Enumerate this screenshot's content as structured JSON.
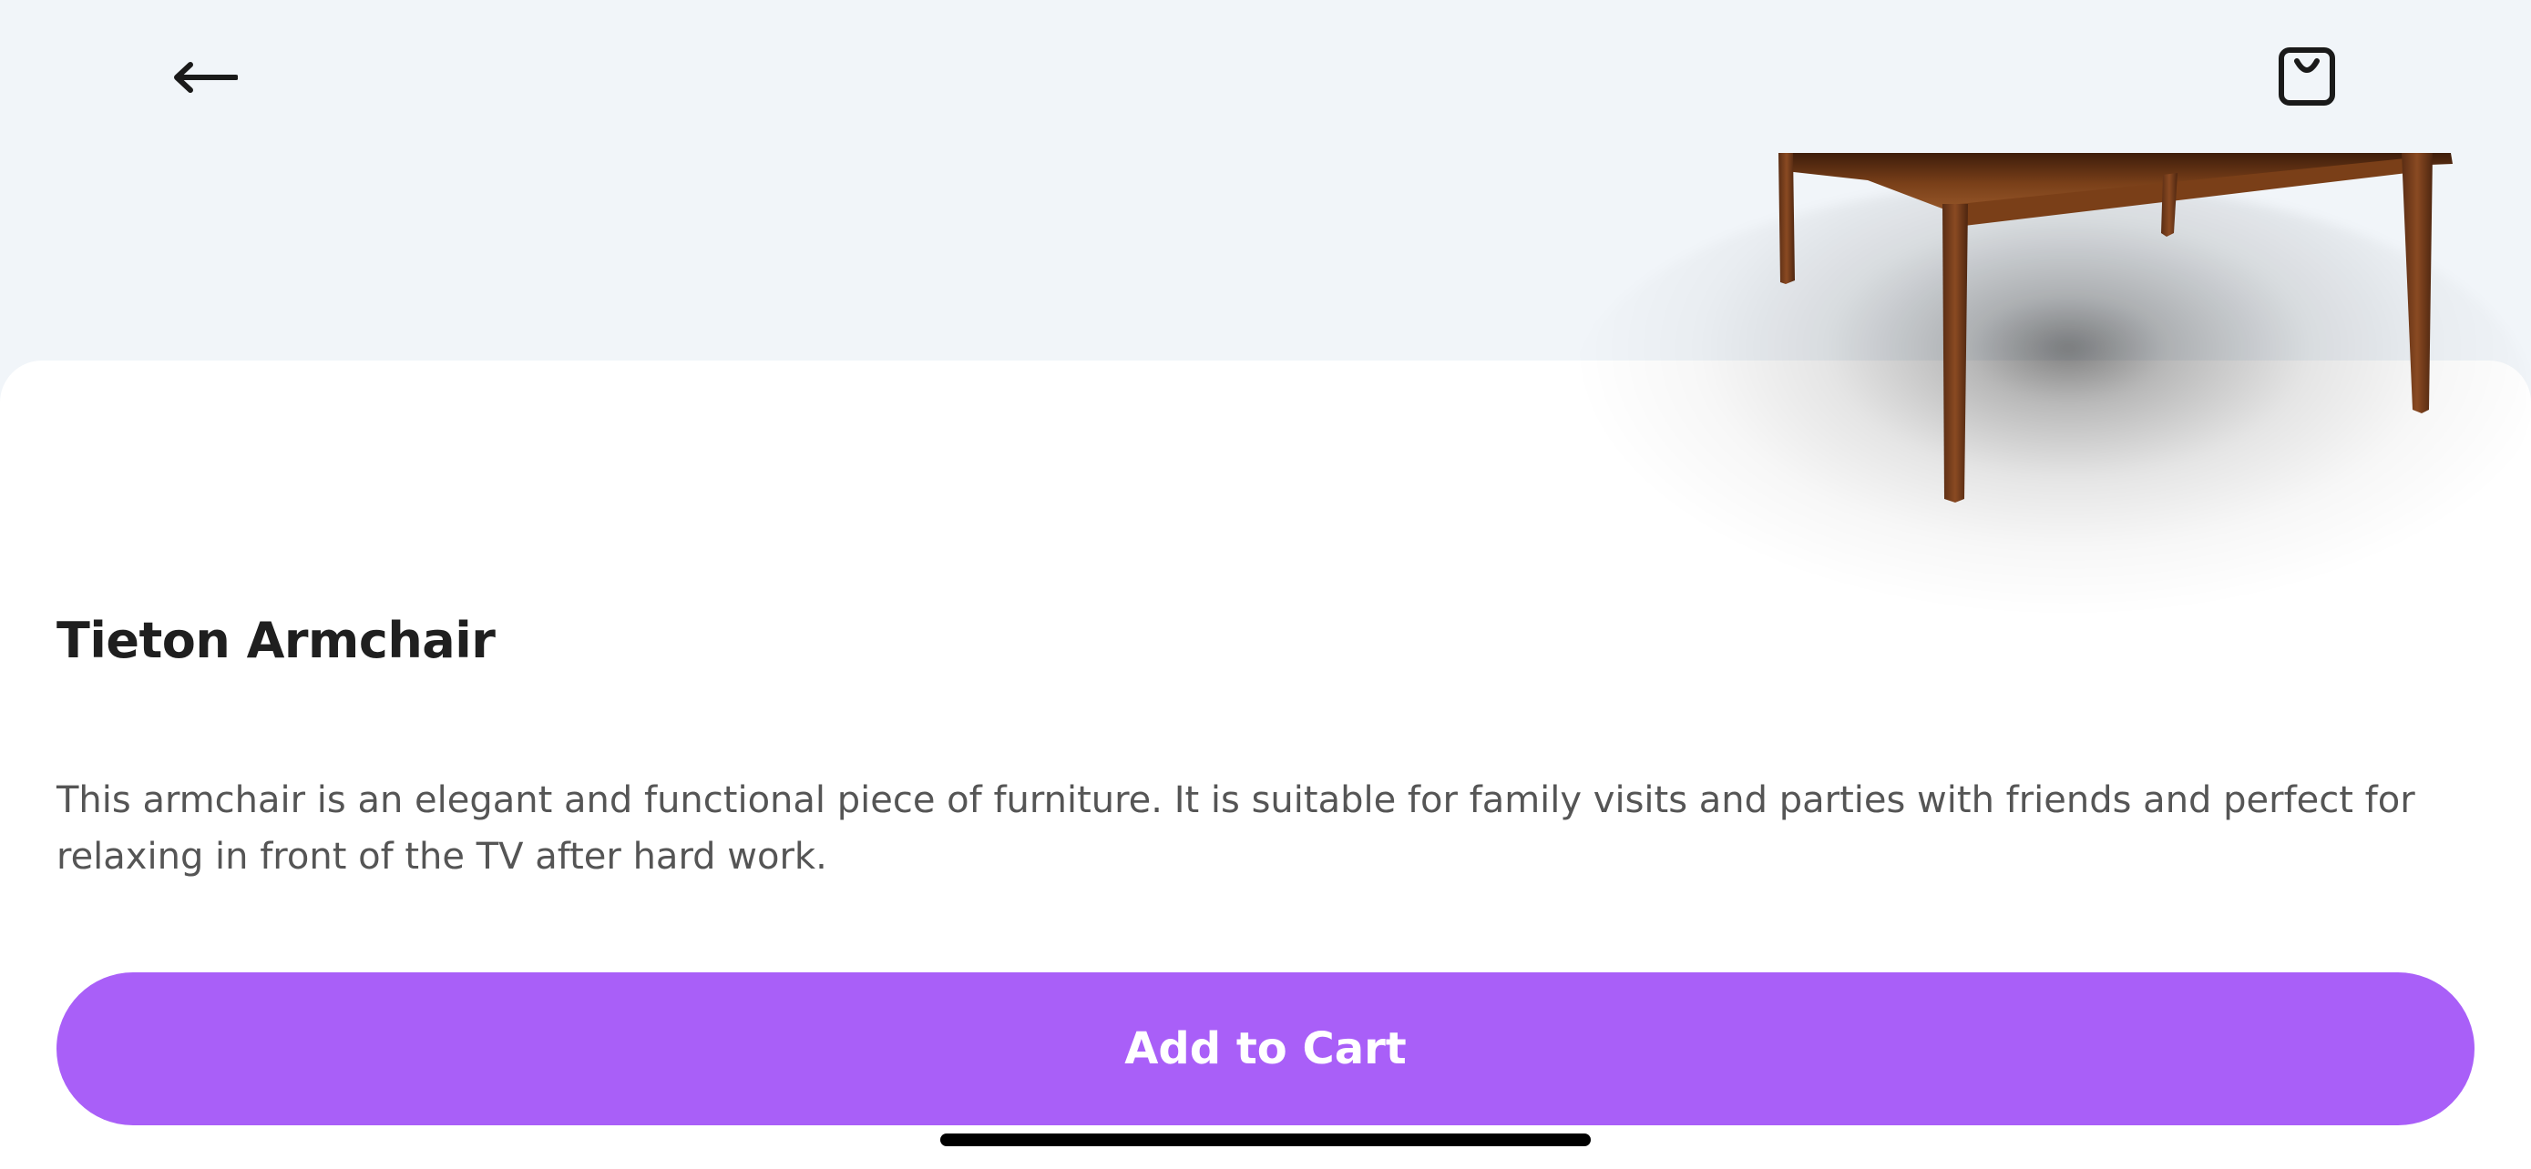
{
  "header": {
    "back_icon": "back-arrow-icon",
    "cart_icon": "shopping-bag-icon"
  },
  "product": {
    "title": "Tieton Armchair",
    "description": "This armchair is an elegant and functional piece of furniture. It is suitable for family visits and parties with friends and perfect for relaxing in front of the TV after hard work.",
    "image": "armchair-product-image"
  },
  "actions": {
    "add_to_cart_label": "Add to Cart"
  },
  "colors": {
    "accent": "#a95ff8",
    "background": "#f1f5f9",
    "sheet": "#ffffff",
    "title": "#1f1f1f",
    "body_text": "#555555"
  }
}
